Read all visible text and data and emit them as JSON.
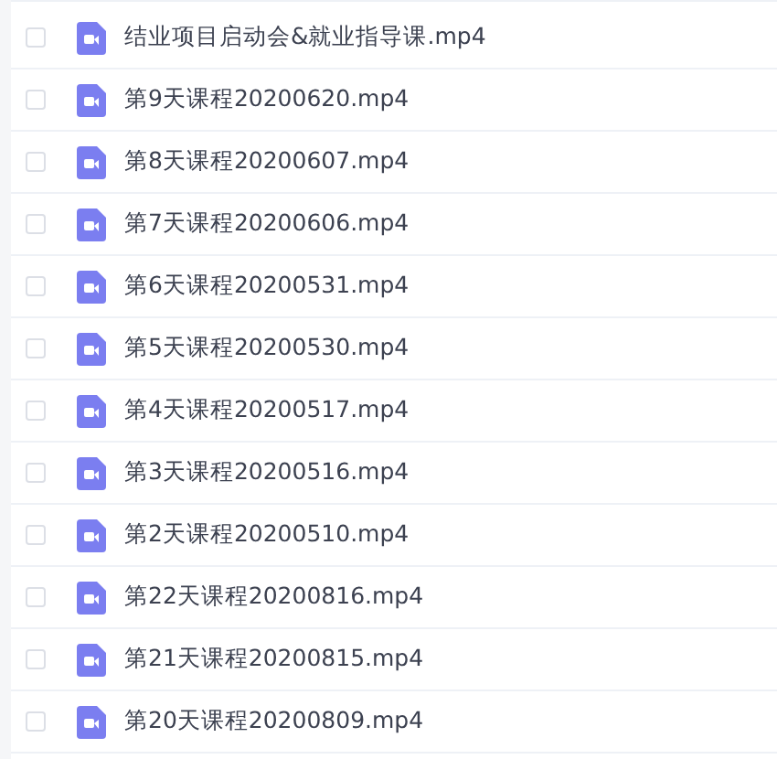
{
  "files": [
    {
      "name": "结业项目启动会&就业指导课.mp4",
      "checked": false
    },
    {
      "name": "第9天课程20200620.mp4",
      "checked": false
    },
    {
      "name": "第8天课程20200607.mp4",
      "checked": false
    },
    {
      "name": "第7天课程20200606.mp4",
      "checked": false
    },
    {
      "name": "第6天课程20200531.mp4",
      "checked": false
    },
    {
      "name": "第5天课程20200530.mp4",
      "checked": false
    },
    {
      "name": "第4天课程20200517.mp4",
      "checked": false
    },
    {
      "name": "第3天课程20200516.mp4",
      "checked": false
    },
    {
      "name": "第2天课程20200510.mp4",
      "checked": false
    },
    {
      "name": "第22天课程20200816.mp4",
      "checked": false
    },
    {
      "name": "第21天课程20200815.mp4",
      "checked": false
    },
    {
      "name": "第20天课程20200809.mp4",
      "checked": false
    }
  ]
}
